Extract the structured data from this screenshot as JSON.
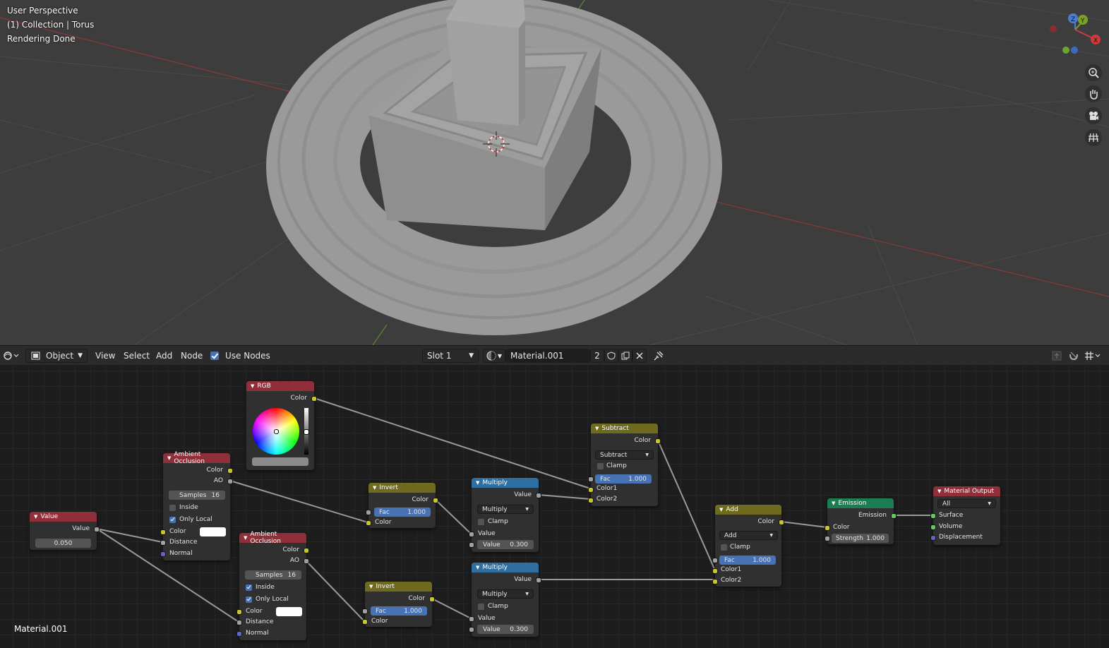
{
  "viewport": {
    "overlay": [
      "User Perspective",
      "(1) Collection | Torus",
      "Rendering Done"
    ],
    "axes": {
      "x": "X",
      "y": "Y",
      "z": "Z"
    },
    "nav_icons": [
      "zoom-icon",
      "hand-pan-icon",
      "camera-icon",
      "grid-ortho-icon"
    ]
  },
  "header": {
    "editor_type_icon": "node-editor-icon",
    "object_mode": "Object",
    "menus": [
      "View",
      "Select",
      "Add",
      "Node"
    ],
    "use_nodes_label": "Use Nodes",
    "use_nodes_checked": true,
    "slot": "Slot 1",
    "material_name": "Material.001",
    "user_count": "2"
  },
  "nodes": {
    "rgb": {
      "title": "RGB",
      "out_color": "Color"
    },
    "ao1": {
      "title": "Ambient Occlusion",
      "out_color": "Color",
      "out_ao": "AO",
      "samples_label": "Samples",
      "samples": "16",
      "inside": "Inside",
      "inside_checked": false,
      "only_local": "Only Local",
      "only_local_checked": true,
      "in_color": "Color",
      "in_distance": "Distance",
      "in_normal": "Normal"
    },
    "ao2": {
      "title": "Ambient Occlusion",
      "out_color": "Color",
      "out_ao": "AO",
      "samples_label": "Samples",
      "samples": "16",
      "inside": "Inside",
      "inside_checked": true,
      "only_local": "Only Local",
      "only_local_checked": true,
      "in_color": "Color",
      "in_distance": "Distance",
      "in_normal": "Normal"
    },
    "value": {
      "title": "Value",
      "out_value": "Value",
      "value": "0.050"
    },
    "invert1": {
      "title": "Invert",
      "out_color": "Color",
      "fac_label": "Fac",
      "fac": "1.000",
      "in_color": "Color"
    },
    "invert2": {
      "title": "Invert",
      "out_color": "Color",
      "fac_label": "Fac",
      "fac": "1.000",
      "in_color": "Color"
    },
    "multiply1": {
      "title": "Multiply",
      "out_value": "Value",
      "op": "Multiply",
      "clamp": "Clamp",
      "in_value": "Value",
      "value_label": "Value",
      "value": "0.300"
    },
    "multiply2": {
      "title": "Multiply",
      "out_value": "Value",
      "op": "Multiply",
      "clamp": "Clamp",
      "in_value": "Value",
      "value_label": "Value",
      "value": "0.300"
    },
    "subtract": {
      "title": "Subtract",
      "out_color": "Color",
      "op": "Subtract",
      "clamp": "Clamp",
      "fac_label": "Fac",
      "fac": "1.000",
      "color1": "Color1",
      "color2": "Color2"
    },
    "add": {
      "title": "Add",
      "out_color": "Color",
      "op": "Add",
      "clamp": "Clamp",
      "fac_label": "Fac",
      "fac": "1.000",
      "color1": "Color1",
      "color2": "Color2"
    },
    "emission": {
      "title": "Emission",
      "out_emission": "Emission",
      "in_color": "Color",
      "strength_label": "Strength",
      "strength": "1.000"
    },
    "output": {
      "title": "Material Output",
      "target": "All",
      "surface": "Surface",
      "volume": "Volume",
      "displacement": "Displacement"
    }
  },
  "footer": {
    "material_label": "Material.001"
  }
}
